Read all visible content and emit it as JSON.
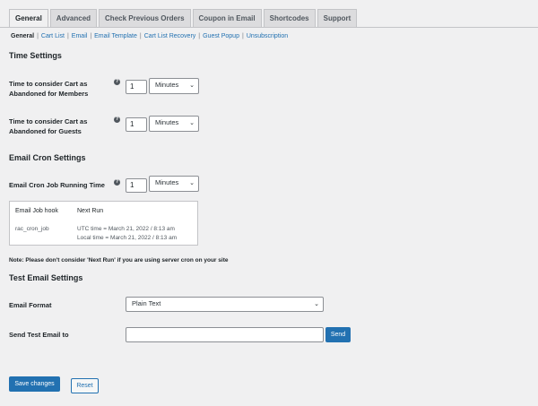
{
  "tabs": [
    "General",
    "Advanced",
    "Check Previous Orders",
    "Coupon in Email",
    "Shortcodes",
    "Support"
  ],
  "subnav": [
    "General",
    "Cart List",
    "Email",
    "Email Template",
    "Cart List Recovery",
    "Guest Popup",
    "Unsubscription"
  ],
  "time_settings": {
    "heading": "Time Settings",
    "members": {
      "label_line1": "Time to consider Cart as",
      "label_line2": "Abandoned for Members",
      "value": "1",
      "unit": "Minutes"
    },
    "guests": {
      "label_line1": "Time to consider Cart as",
      "label_line2": "Abandoned for Guests",
      "value": "1",
      "unit": "Minutes"
    }
  },
  "email_cron": {
    "heading": "Email Cron Settings",
    "label": "Email Cron Job Running Time",
    "value": "1",
    "unit": "Minutes",
    "table": {
      "col1": "Email Job hook",
      "col2": "Next Run",
      "hook": "rac_cron_job",
      "utc": "UTC time = March 21, 2022 / 8:13 am",
      "local": "Local time = March 21, 2022 / 8:13 am"
    },
    "note": "Note: Please don't consider 'Next Run' if you are using server cron on your site"
  },
  "test_email": {
    "heading": "Test Email Settings",
    "format_label": "Email Format",
    "format_value": "Plain Text",
    "send_label": "Send Test Email to",
    "send_value": "",
    "send_button": "Send"
  },
  "footer": {
    "save": "Save changes",
    "reset": "Reset"
  },
  "icons": {
    "help": "help-icon",
    "select": "chevron-down-icon"
  },
  "colors": {
    "accent": "#2271b1",
    "background": "#f0f0f1"
  }
}
